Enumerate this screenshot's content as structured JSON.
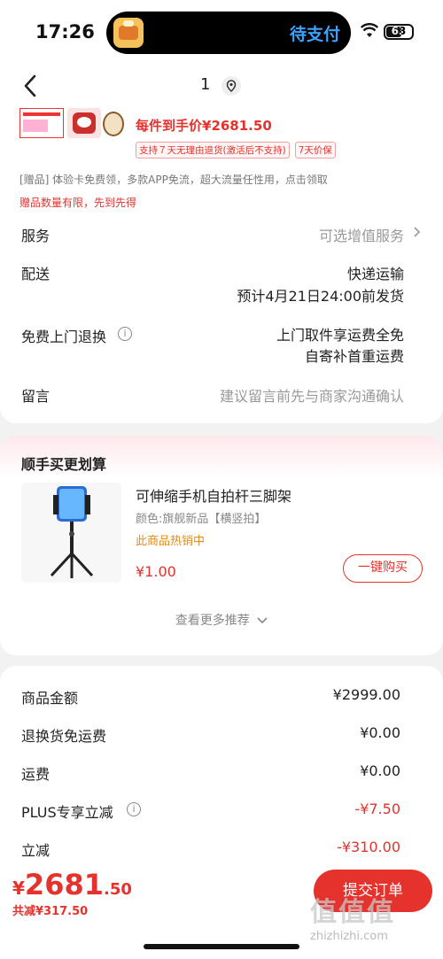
{
  "status": {
    "time": "17:26",
    "island_text": "待支付",
    "battery": "63",
    "battery_level": 0.63
  },
  "nav": {
    "count": "1"
  },
  "product": {
    "price_each": "每件到手价¥2681.50",
    "tags": [
      "支持７天无理由退货(激活后不支持)",
      "7天价保"
    ],
    "gift": "[赠品] 体验卡免费领，多款APP免流，超大流量任性用，点击领取",
    "gift_note": "赠品数量有限，先到先得"
  },
  "rows": {
    "service_label": "服务",
    "service_value": "可选增值服务",
    "delivery_label": "配送",
    "delivery_value": "快递运输",
    "delivery_eta": "预计4月21日24:00前发货",
    "return_label": "免费上门退换",
    "return_value_1": "上门取件享运费全免",
    "return_value_2": "自寄补首重运费",
    "note_label": "留言",
    "note_placeholder": "建议留言前先与商家沟通确认"
  },
  "recommend": {
    "title": "顺手买更划算",
    "name": "可伸缩手机自拍杆三脚架",
    "spec": "颜色:旗舰新品【横竖拍】",
    "hot": "此商品热销中",
    "price": "¥1.00",
    "buy_label": "一键购买",
    "more_label": "查看更多推荐"
  },
  "summary": {
    "items": [
      {
        "label": "商品金额",
        "value": "¥2999.00"
      },
      {
        "label": "退换货免运费",
        "value": "¥0.00"
      },
      {
        "label": "运费",
        "value": "¥0.00"
      },
      {
        "label": "PLUS专享立减",
        "value": "-¥7.50"
      },
      {
        "label": "立减",
        "value": "-¥310.00"
      }
    ]
  },
  "footer": {
    "currency": "¥",
    "total_int": "2681",
    "total_dec": ".50",
    "saved": "共减¥317.50",
    "submit_label": "提交订单",
    "watermark": "值值值",
    "watermark_sub": "zhizhizhi.com"
  },
  "colors": {
    "accent": "#e5322d",
    "island_text": "#3aa2ff"
  }
}
